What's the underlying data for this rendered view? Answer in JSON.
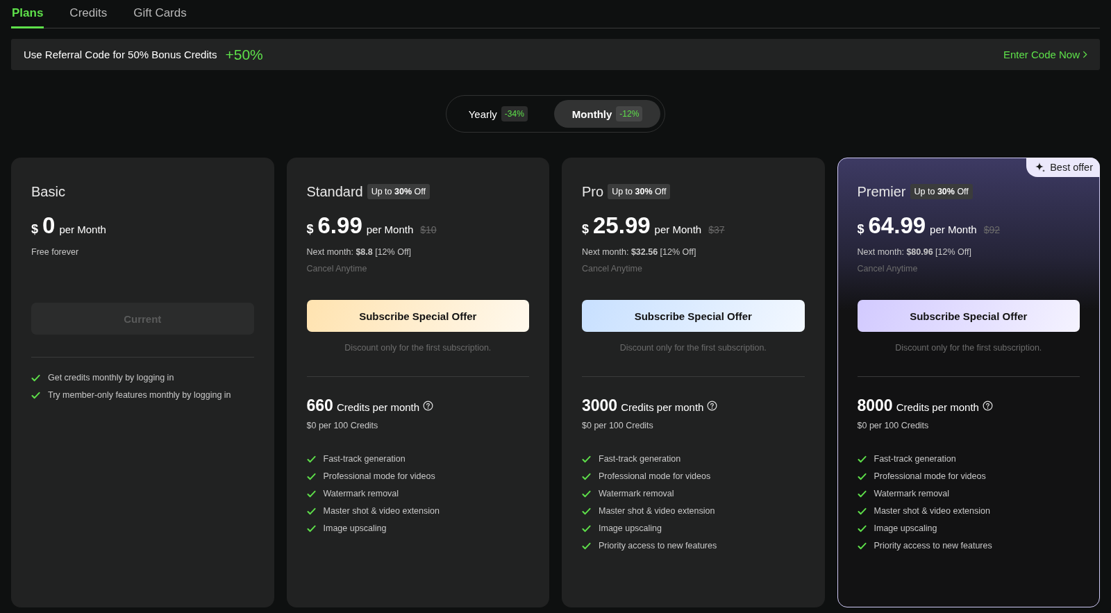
{
  "tabs": [
    {
      "label": "Plans",
      "selected": true
    },
    {
      "label": "Credits",
      "selected": false
    },
    {
      "label": "Gift Cards",
      "selected": false
    }
  ],
  "referral": {
    "text": "Use Referral Code for 50% Bonus Credits",
    "bonus": "+50%",
    "link": "Enter Code Now"
  },
  "billing_toggle": [
    {
      "label": "Yearly",
      "discount": "-34%",
      "selected": false
    },
    {
      "label": "Monthly",
      "discount": "-12%",
      "selected": true
    }
  ],
  "plans": [
    {
      "name": "Basic",
      "kind": "free",
      "featured": false,
      "currency": "$",
      "price": "0",
      "period": "per Month",
      "subtitle": "Free forever",
      "button": {
        "label": "Current",
        "disabled": true
      },
      "features": [
        "Get credits monthly by logging in",
        "Try member-only features monthly by logging in"
      ]
    },
    {
      "name": "Standard",
      "kind": "paid",
      "featured": false,
      "color": "#ffe3b0",
      "badge": "Up to **30%** Off",
      "currency": "$",
      "price": "6.99",
      "period": "per Month",
      "old_price": "$10",
      "next_month": "Next month: **$8.8** [12% Off]",
      "note": "Cancel Anytime",
      "button": {
        "label": "Subscribe Special Offer",
        "disabled": false
      },
      "disclaimer": "Discount only for the first subscription.",
      "credits_amount": "660",
      "credits_label": "Credits per month",
      "credits_rate": "$0 per 100 Credits",
      "features": [
        "Fast-track generation",
        "Professional mode for videos",
        "Watermark removal",
        "Master shot & video extension",
        "Image upscaling"
      ]
    },
    {
      "name": "Pro",
      "kind": "paid",
      "featured": false,
      "color": "#c8e0ff",
      "badge": "Up to **30%** Off",
      "currency": "$",
      "price": "25.99",
      "period": "per Month",
      "old_price": "$37",
      "next_month": "Next month: **$32.56** [12% Off]",
      "note": "Cancel Anytime",
      "button": {
        "label": "Subscribe Special Offer",
        "disabled": false
      },
      "disclaimer": "Discount only for the first subscription.",
      "credits_amount": "3000",
      "credits_label": "Credits per month",
      "credits_rate": "$0 per 100 Credits",
      "features": [
        "Fast-track generation",
        "Professional mode for videos",
        "Watermark removal",
        "Master shot & video extension",
        "Image upscaling",
        "Priority access to new features"
      ]
    },
    {
      "name": "Premier",
      "kind": "paid",
      "featured": true,
      "ribbon": "Best offer",
      "color": "#d2caff",
      "badge": "Up to **30%** Off",
      "currency": "$",
      "price": "64.99",
      "period": "per Month",
      "old_price": "$92",
      "next_month": "Next month: **$80.96** [12% Off]",
      "note": "Cancel Anytime",
      "button": {
        "label": "Subscribe Special Offer",
        "disabled": false
      },
      "disclaimer": "Discount only for the first subscription.",
      "credits_amount": "8000",
      "credits_label": "Credits per month",
      "credits_rate": "$0 per 100 Credits",
      "features": [
        "Fast-track generation",
        "Professional mode for videos",
        "Watermark removal",
        "Master shot & video extension",
        "Image upscaling",
        "Priority access to new features"
      ]
    }
  ]
}
